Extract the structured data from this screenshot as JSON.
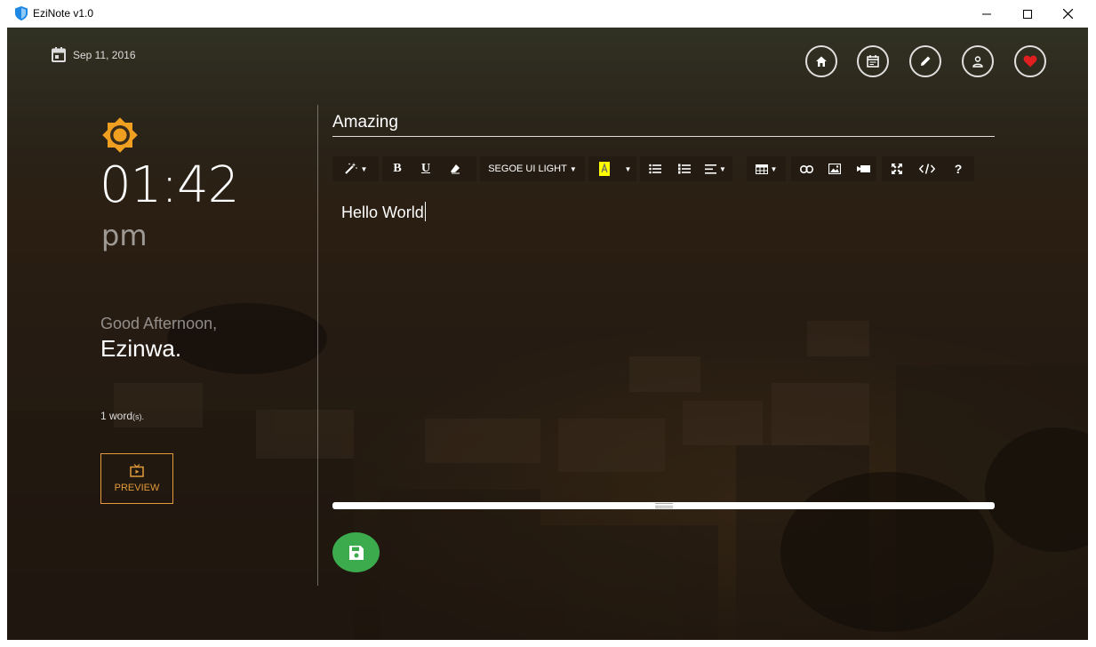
{
  "window": {
    "title": "EziNote v1.0",
    "controls": [
      "minimize-icon",
      "maximize-icon",
      "close-icon"
    ]
  },
  "header": {
    "date": "Sep 11, 2016",
    "nav_icons": [
      "home-icon",
      "calendar-icon",
      "pencil-icon",
      "user-icon",
      "heart-icon"
    ]
  },
  "sidebar": {
    "weather_icon": "sun-icon",
    "time": "01:42",
    "ampm": "pm",
    "greeting": "Good Afternoon,",
    "name": "Ezinwa.",
    "word_count": "1 word",
    "word_unit": "(s).",
    "preview_label": "PREVIEW"
  },
  "editor": {
    "note_title": "Amazing",
    "font_name": "SEGOE UI LIGHT",
    "bold_label": "B",
    "underline_label": "U",
    "help_label": "?",
    "content": "Hello World",
    "highlight_color": "#ffff00",
    "toolbar_icons": [
      "magic-wand-icon",
      "bold-icon",
      "underline-icon",
      "eraser-icon",
      "font-dropdown",
      "highlight-color-icon",
      "unordered-list-icon",
      "ordered-list-icon",
      "align-icon",
      "table-icon",
      "link-icon",
      "image-icon",
      "video-icon",
      "fullscreen-icon",
      "code-view-icon",
      "help-icon"
    ]
  },
  "colors": {
    "accent": "#e39a3a",
    "save_green": "#3cab4e",
    "heart_red": "#e02020",
    "sun_orange": "#f0a020"
  }
}
